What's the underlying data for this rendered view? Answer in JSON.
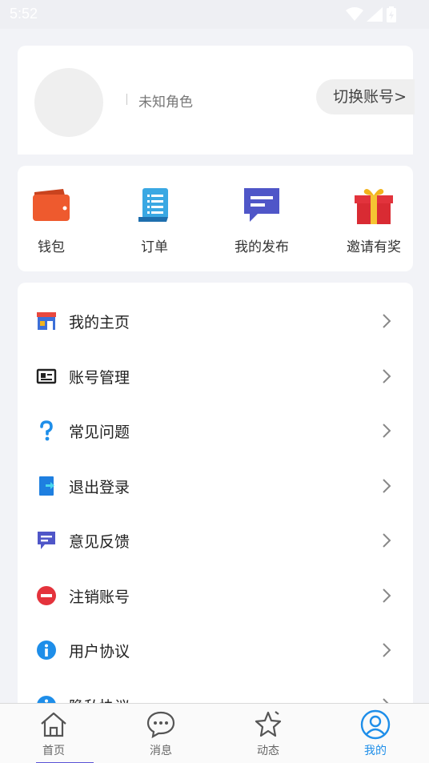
{
  "status_bar": {
    "time": "5:52"
  },
  "profile": {
    "role": "未知角色",
    "switch_account": "切换账号>"
  },
  "quick_actions": [
    {
      "label": "钱包",
      "icon": "wallet-icon"
    },
    {
      "label": "订单",
      "icon": "order-list-icon"
    },
    {
      "label": "我的发布",
      "icon": "message-icon"
    },
    {
      "label": "邀请有奖",
      "icon": "gift-icon"
    }
  ],
  "menu": [
    {
      "label": "我的主页",
      "icon": "shop-icon"
    },
    {
      "label": "账号管理",
      "icon": "id-card-icon"
    },
    {
      "label": "常见问题",
      "icon": "question-icon"
    },
    {
      "label": "退出登录",
      "icon": "logout-icon"
    },
    {
      "label": "意见反馈",
      "icon": "feedback-icon"
    },
    {
      "label": "注销账号",
      "icon": "minus-circle-icon"
    },
    {
      "label": "用户协议",
      "icon": "info-icon"
    },
    {
      "label": "隐私协议",
      "icon": "info-icon"
    }
  ],
  "bottom_nav": [
    {
      "label": "首页",
      "icon": "home-icon"
    },
    {
      "label": "消息",
      "icon": "chat-icon"
    },
    {
      "label": "动态",
      "icon": "star-icon"
    },
    {
      "label": "我的",
      "icon": "user-icon",
      "active": true
    }
  ],
  "colors": {
    "accent": "#1e8ee9",
    "background": "#f2f3f7"
  }
}
